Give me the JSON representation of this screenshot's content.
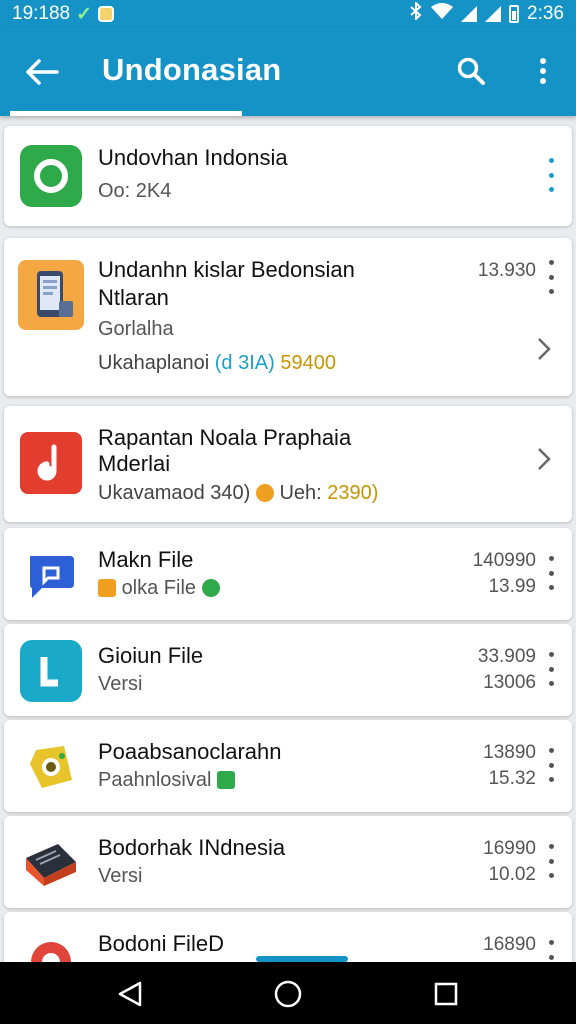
{
  "status_bar": {
    "time": "19:188",
    "clock": "2:36",
    "icons": [
      "v-icon",
      "notification-icon",
      "bluetooth-icon",
      "wifi-icon",
      "signal-icon",
      "signal-icon",
      "battery-icon"
    ]
  },
  "app_bar": {
    "title": "Undonasian",
    "back_icon": "arrow-left-icon",
    "search_icon": "search-icon",
    "more_icon": "more-vert-icon"
  },
  "items": [
    {
      "title": "Undovhan Indonsia",
      "subtitle": "Oo: 2K4",
      "icon": "green-ring-icon",
      "icon_color": "#2eaa4a"
    },
    {
      "title_line1": "Undanhn kislar Bedonsian",
      "title_line2": "Ntlaran",
      "subtitle": "Gorlalha",
      "detail_prefix": "Ukahaplanoi",
      "detail_link": "(d 3IA)",
      "detail_value": "59400",
      "meta": "13.930",
      "icon": "phone-app-icon",
      "icon_color": "#f4a742"
    },
    {
      "title_line1": "Rapantan Noala Praphaia",
      "title_line2": "Mderlai",
      "detail_prefix": "Ukavamaod 340)",
      "detail_mid": "Ueh:",
      "detail_value": "2390)",
      "icon": "music-note-icon",
      "icon_color": "#e23d2f"
    },
    {
      "title": "Makn File",
      "subtitle": "olka File",
      "meta1": "140990",
      "meta2": "13.99",
      "icon": "chat-bubble-icon",
      "icon_color": "#2d5fd6"
    },
    {
      "title": "Gioiun File",
      "subtitle": "Versi",
      "meta1": "33.909",
      "meta2": "13006",
      "icon": "teal-l-icon",
      "icon_color": "#1aa9c9"
    },
    {
      "title": "Poaabsanoclarahn",
      "subtitle": "Paahnlosival",
      "meta1": "13890",
      "meta2": "15.32",
      "icon": "yellow-camera-icon",
      "icon_color": "#e7c42b"
    },
    {
      "title": "Bodorhak INdnesia",
      "subtitle": "Versi",
      "meta1": "16990",
      "meta2": "10.02",
      "icon": "box-icon",
      "icon_color": "#e8542c"
    },
    {
      "title": "Bodoni FileD",
      "meta1": "16890",
      "icon": "red-ring-icon",
      "icon_color": "#e0443a"
    }
  ],
  "nav_bar": {
    "back_icon": "nav-back-icon",
    "home_icon": "nav-home-icon",
    "recents_icon": "nav-recents-icon"
  },
  "colors": {
    "primary": "#1593c6",
    "accent": "#1a9fd0",
    "gold": "#c89400"
  }
}
